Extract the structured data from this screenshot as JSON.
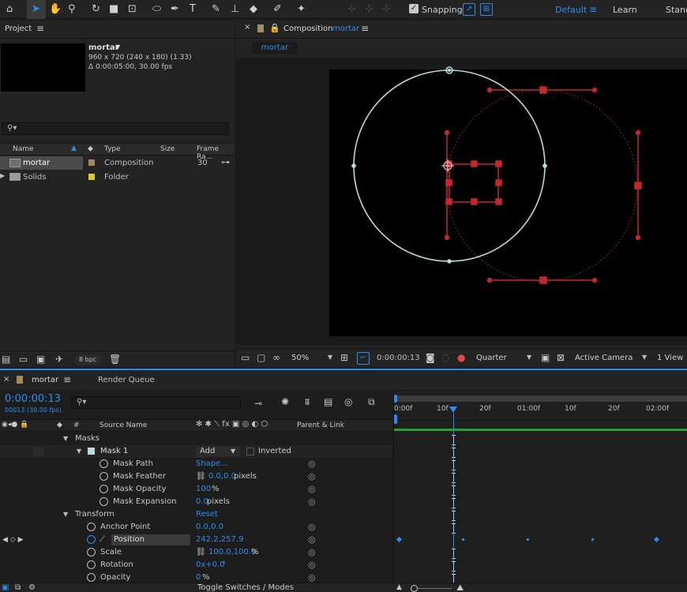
{
  "toolbar": {
    "snapping_label": "Snapping",
    "workspaces": [
      "Default",
      "Learn",
      "Stand"
    ]
  },
  "project": {
    "title": "Project",
    "item_name": "mortar",
    "dimensions": "960 x 720  (240 x 180) (1.33)",
    "duration": "Δ 0:00:05:00, 30.00 fps",
    "columns": [
      "Name",
      "Type",
      "Size",
      "Frame Ra..."
    ],
    "items": [
      {
        "name": "mortar",
        "type": "Composition",
        "frame_rate": "30",
        "color": "#a08c5e"
      },
      {
        "name": "Solids",
        "type": "Folder",
        "frame_rate": "",
        "color": "#e0c92c"
      }
    ],
    "bpc": "8 bpc"
  },
  "composition": {
    "title": "Composition",
    "name": "mortar",
    "tab": "mortar",
    "zoom": "50%",
    "timecode": "0:00:00:13",
    "resolution": "Quarter",
    "camera": "Active Camera",
    "views": "1 View"
  },
  "timeline": {
    "tab": "mortar",
    "render_queue": "Render Queue",
    "timecode": "0:00:00:13",
    "frame_info": "00013 (30.00 fps)",
    "col_hash": "#",
    "col_source": "Source Name",
    "col_parent": "Parent & Link",
    "ruler": [
      "0:00f",
      "10f",
      "20f",
      "01:00f",
      "10f",
      "20f",
      "02:00f"
    ],
    "masks_label": "Masks",
    "mask1": "Mask 1",
    "mask_mode": "Add",
    "inverted": "Inverted",
    "mask_props": [
      {
        "name": "Mask Path",
        "value": "Shape..."
      },
      {
        "name": "Mask Feather",
        "value": "0.0,0.0",
        "unit": " pixels"
      },
      {
        "name": "Mask Opacity",
        "value": "100",
        "unit": "%"
      },
      {
        "name": "Mask Expansion",
        "value": "0.0",
        "unit": " pixels"
      }
    ],
    "transform_label": "Transform",
    "reset": "Reset",
    "transform_props": [
      {
        "name": "Anchor Point",
        "value": "0.0,0.0"
      },
      {
        "name": "Position",
        "value": "242.2,257.9"
      },
      {
        "name": "Scale",
        "value": "100.0,100.0",
        "unit": "%"
      },
      {
        "name": "Rotation",
        "value": "0x+0.0",
        "unit": "°"
      },
      {
        "name": "Opacity",
        "value": "0",
        "unit": "%"
      }
    ],
    "toggle": "Toggle Switches / Modes"
  },
  "colors": {
    "accent": "#2d8ceb",
    "mask_red": "#c0282e",
    "circle": "#b8dcdc",
    "work_area": "#22a32c"
  }
}
